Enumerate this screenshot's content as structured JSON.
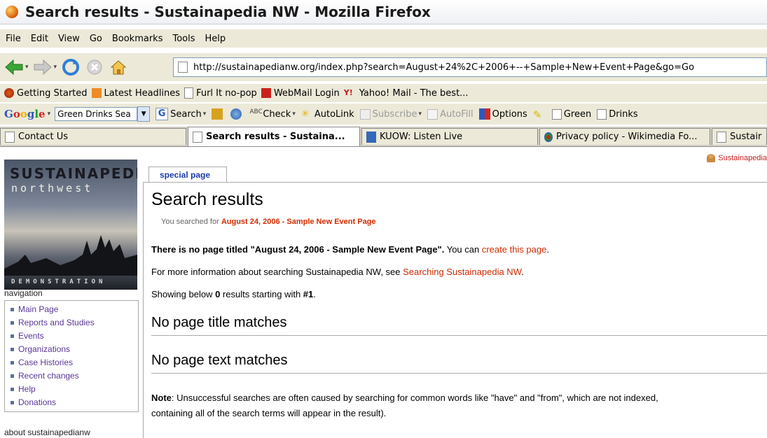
{
  "window": {
    "title": "Search results - Sustainapedia NW - Mozilla Firefox"
  },
  "menu": [
    "File",
    "Edit",
    "View",
    "Go",
    "Bookmarks",
    "Tools",
    "Help"
  ],
  "address_bar": {
    "url": "http://sustainapedianw.org/index.php?search=August+24%2C+2006+--+Sample+New+Event+Page&go=Go"
  },
  "bookmarks": [
    {
      "label": "Getting Started",
      "icon": "firefox-icon"
    },
    {
      "label": "Latest Headlines",
      "icon": "rss-icon"
    },
    {
      "label": "Furl It no-pop",
      "icon": "page-icon"
    },
    {
      "label": "WebMail Login",
      "icon": "webmail-icon"
    },
    {
      "label": "Yahoo! Mail - The best...",
      "icon": "yahoo-icon"
    }
  ],
  "google_toolbar": {
    "logo": "Google",
    "search_value": "Green Drinks Sea",
    "items": {
      "search": "Search",
      "check": "Check",
      "autolink": "AutoLink",
      "subscribe": "Subscribe",
      "autofill": "AutoFill",
      "options": "Options",
      "green": "Green",
      "drinks": "Drinks"
    }
  },
  "tabs": [
    {
      "label": "Contact Us",
      "active": false
    },
    {
      "label": "Search results - Sustaina...",
      "active": true
    },
    {
      "label": "KUOW: Listen Live",
      "active": false
    },
    {
      "label": "Privacy policy - Wikimedia Fo...",
      "active": false
    },
    {
      "label": "Sustair",
      "active": false
    }
  ],
  "site": {
    "logo_line1": "SUSTAINAPEDIA",
    "logo_line2": "northwest",
    "logo_line3": "DEMONSTRATION",
    "user_link": "Sustainapedia"
  },
  "sidebar": {
    "nav_heading": "navigation",
    "items": [
      "Main Page",
      "Reports and Studies",
      "Events",
      "Organizations",
      "Case Histories",
      "Recent changes",
      "Help",
      "Donations"
    ],
    "about_heading": "about sustainapedianw"
  },
  "page": {
    "tab_label": "special page",
    "title": "Search results",
    "searched_for_prefix": "You searched for ",
    "searched_for_query": "August 24, 2006 - Sample New Event Page",
    "no_page_bold": "There is no page titled \"August 24, 2006 - Sample New Event Page\".",
    "you_can": " You can ",
    "create_link": "create this page",
    "period": ".",
    "more_info_prefix": "For more information about searching Sustainapedia NW, see ",
    "more_info_link": "Searching Sustainapedia NW",
    "showing_prefix": "Showing below ",
    "showing_count": "0",
    "showing_mid": " results starting with ",
    "showing_start": "#1",
    "no_title_matches": "No page title matches",
    "no_text_matches": "No page text matches",
    "note_label": "Note",
    "note_text": ": Unsuccessful searches are often caused by searching for common words like \"have\" and \"from\", which are not indexed,",
    "note_text2": "containing all of the search terms will appear in the result)."
  }
}
